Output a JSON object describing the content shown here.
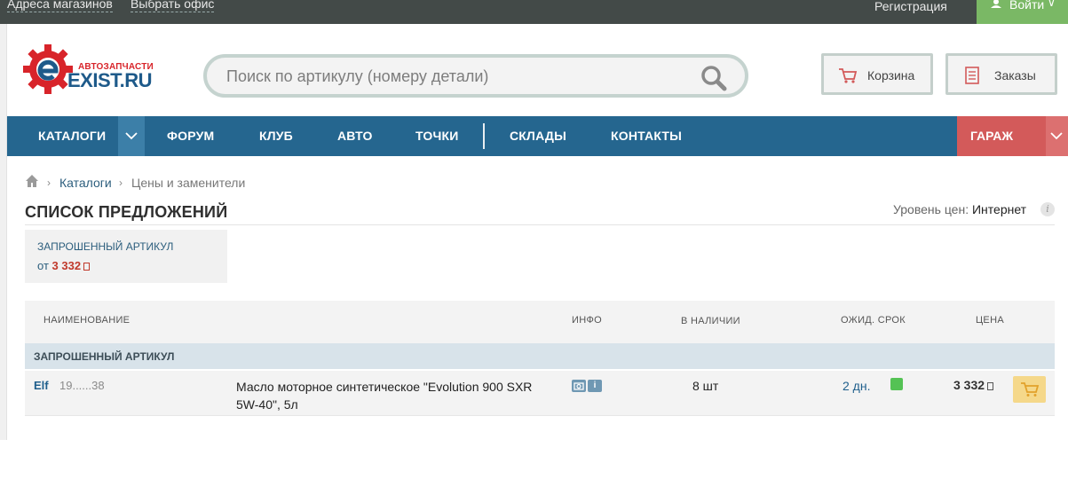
{
  "topbar": {
    "stores_link": "Адреса магазинов",
    "office_link": "Выбрать офис",
    "register": "Регистрация",
    "login": "Войти"
  },
  "header": {
    "logo_small": "АВТОЗАПЧАСТИ",
    "logo_big": "EXIST.RU",
    "search_placeholder": "Поиск по артикулу (номеру детали)",
    "cart": "Корзина",
    "orders": "Заказы"
  },
  "nav": {
    "items": [
      "КАТАЛОГИ",
      "ФОРУМ",
      "КЛУБ",
      "АВТО",
      "ТОЧКИ",
      "СКЛАДЫ",
      "КОНТАКТЫ"
    ],
    "garage": "ГАРАЖ"
  },
  "breadcrumb": {
    "items": [
      "Каталоги",
      "Цены и заменители"
    ],
    "separator": "›"
  },
  "page": {
    "title": "СПИСОК ПРЕДЛОЖЕНИЙ",
    "price_level_label": "Уровень цен:",
    "price_level_value": "Интернет"
  },
  "requested": {
    "title": "ЗАПРОШЕННЫЙ АРТИКУЛ",
    "from_label": "от",
    "from_price": "3 332"
  },
  "table": {
    "headers": {
      "name": "НАИМЕНОВАНИЕ",
      "info": "ИНФО",
      "stock": "В НАЛИЧИИ",
      "eta": "ОЖИД. СРОК",
      "price": "ЦЕНА"
    },
    "group_label": "ЗАПРОШЕННЫЙ АРТИКУЛ",
    "rows": [
      {
        "brand": "Elf",
        "code": "19......38",
        "name": "Масло моторное синтетическое \"Evolution 900 SXR 5W-40\", 5л",
        "stock": "8 шт",
        "eta": "2 дн.",
        "price": "3 332"
      }
    ]
  },
  "colors": {
    "nav": "#25668f",
    "garage": "#d35a5a",
    "login": "#7ab865",
    "brand_blue": "#1e5a8a",
    "brand_red": "#d8242a"
  }
}
